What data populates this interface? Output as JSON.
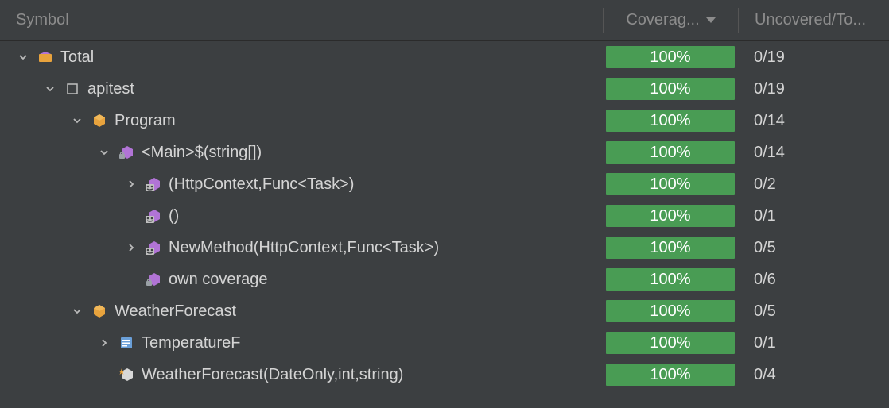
{
  "header": {
    "symbol": "Symbol",
    "coverage": "Coverag...",
    "uncovered": "Uncovered/To..."
  },
  "rows": [
    {
      "indent": 0,
      "chevron": "down",
      "icon": "folder",
      "label": "Total",
      "coverage": "100%",
      "uncovered": "0/19"
    },
    {
      "indent": 1,
      "chevron": "down",
      "icon": "module",
      "label": "apitest",
      "coverage": "100%",
      "uncovered": "0/19"
    },
    {
      "indent": 2,
      "chevron": "down",
      "icon": "class",
      "label": "Program",
      "coverage": "100%",
      "uncovered": "0/14"
    },
    {
      "indent": 3,
      "chevron": "down",
      "icon": "method-lock",
      "label": "<Main>$(string[])",
      "coverage": "100%",
      "uncovered": "0/14"
    },
    {
      "indent": 4,
      "chevron": "right",
      "icon": "lambda",
      "label": "(HttpContext,Func<Task>)",
      "coverage": "100%",
      "uncovered": "0/2"
    },
    {
      "indent": 4,
      "chevron": "none",
      "icon": "lambda",
      "label": "()",
      "coverage": "100%",
      "uncovered": "0/1"
    },
    {
      "indent": 4,
      "chevron": "right",
      "icon": "lambda",
      "label": "NewMethod(HttpContext,Func<Task>)",
      "coverage": "100%",
      "uncovered": "0/5"
    },
    {
      "indent": 4,
      "chevron": "none",
      "icon": "method-lock",
      "label": "own coverage",
      "coverage": "100%",
      "uncovered": "0/6"
    },
    {
      "indent": 2,
      "chevron": "down",
      "icon": "class",
      "label": "WeatherForecast",
      "coverage": "100%",
      "uncovered": "0/5"
    },
    {
      "indent": 3,
      "chevron": "right",
      "icon": "property",
      "label": "TemperatureF",
      "coverage": "100%",
      "uncovered": "0/1"
    },
    {
      "indent": 3,
      "chevron": "none",
      "icon": "method-star",
      "label": "WeatherForecast(DateOnly,int,string)",
      "coverage": "100%",
      "uncovered": "0/4"
    }
  ]
}
